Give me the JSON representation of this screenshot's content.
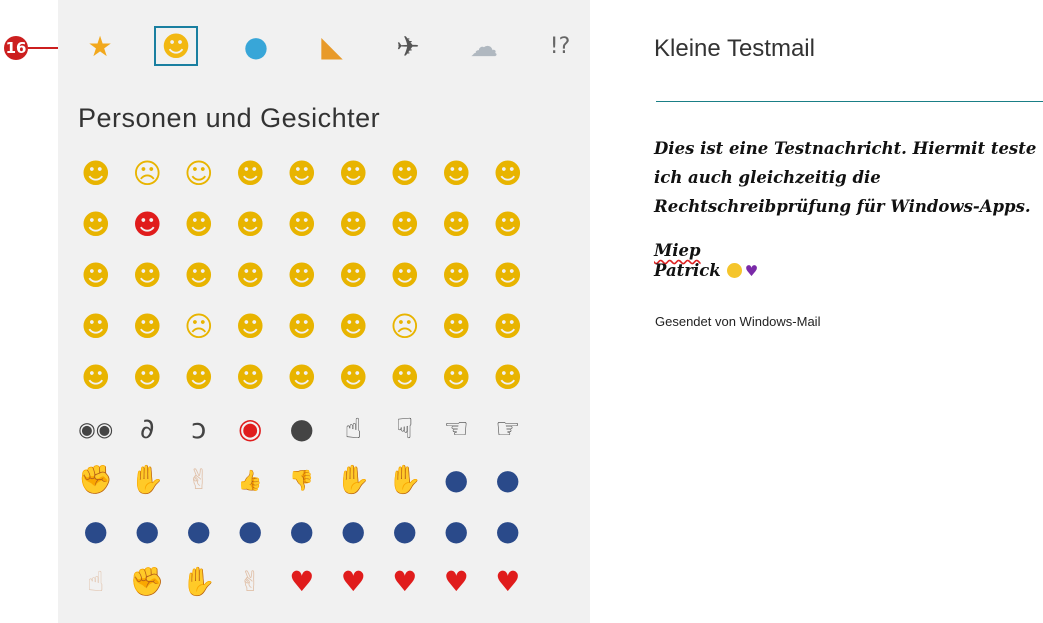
{
  "callout": {
    "number": "16"
  },
  "emoji_panel": {
    "categories": [
      {
        "name": "star-icon",
        "glyph": "★",
        "color": "#f2a81c"
      },
      {
        "name": "smiley-icon",
        "glyph": "☻",
        "color": "#f2b812",
        "selected": true
      },
      {
        "name": "balloon-icon",
        "glyph": "●",
        "color": "#38a6d8"
      },
      {
        "name": "pizza-icon",
        "glyph": "◣",
        "color": "#e89a2a"
      },
      {
        "name": "airplane-icon",
        "glyph": "✈",
        "color": "#555555"
      },
      {
        "name": "weather-icon",
        "glyph": "☁",
        "color": "#b0b8c0"
      },
      {
        "name": "symbols-icon",
        "glyph": "!?",
        "color": "#666666"
      }
    ],
    "section_title": "Personen und Gesichter",
    "grid": [
      [
        "☻",
        "☹",
        "☺",
        "☻",
        "☻",
        "☻",
        "☻",
        "☻",
        "☻"
      ],
      [
        "☻",
        "☻",
        "☻",
        "☻",
        "☻",
        "☻",
        "☻",
        "☻",
        "☻"
      ],
      [
        "☻",
        "☻",
        "☻",
        "☻",
        "☻",
        "☻",
        "☻",
        "☻",
        "☻"
      ],
      [
        "☻",
        "☻",
        "☹",
        "☻",
        "☻",
        "☻",
        "☹",
        "☻",
        "☻"
      ],
      [
        "☻",
        "☻",
        "☻",
        "☻",
        "☻",
        "☻",
        "☻",
        "☻",
        "☻"
      ],
      [
        "◉◉",
        "∂",
        "ↄ",
        "◉",
        "●",
        "☝",
        "☟",
        "☜",
        "☞"
      ],
      [
        "✊",
        "✋",
        "✌",
        "👍",
        "👎",
        "✋",
        "✋",
        "●",
        "●"
      ],
      [
        "●",
        "●",
        "●",
        "●",
        "●",
        "●",
        "●",
        "●",
        "●"
      ],
      [
        "☝",
        "✊",
        "✋",
        "✌",
        "♥",
        "♥",
        "♥",
        "♥",
        "♥"
      ]
    ]
  },
  "mail": {
    "subject": "Kleine Testmail",
    "body": "Dies ist eine Testnachricht. Hiermit teste ich auch gleichzeitig die Rechtschreibprüfung für Windows-Apps.",
    "signature_line1": "Miep",
    "signature_line2": "Patrick",
    "heart": "♥",
    "footer": "Gesendet von Windows-Mail"
  },
  "colors": {
    "accent": "#1a7f86",
    "callout": "#cc1f1f"
  }
}
